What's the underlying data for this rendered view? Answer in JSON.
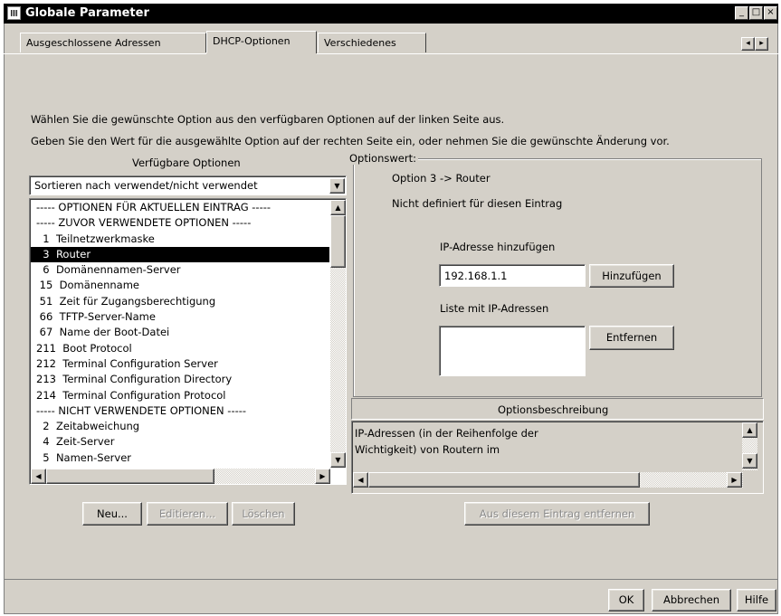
{
  "window": {
    "title": "Globale Parameter",
    "controls": {
      "minimize": "_",
      "maximize": "□",
      "close": "×"
    }
  },
  "tabs": [
    {
      "label": "Ausgeschlossene Adressen",
      "active": false
    },
    {
      "label": "DHCP-Optionen",
      "active": true
    },
    {
      "label": "Verschiedenes",
      "active": false
    }
  ],
  "tab_scroll": {
    "left": "◂",
    "right": "▸"
  },
  "instructions": {
    "line1": "Wählen Sie die gewünschte Option aus den verfügbaren Optionen auf der linken Seite aus.",
    "line2": "Geben Sie den Wert für die ausgewählte Option auf der rechten Seite ein, oder nehmen Sie die gewünschte Änderung vor."
  },
  "available": {
    "heading": "Verfügbare Optionen",
    "sort_select": "Sortieren nach verwendet/nicht verwendet",
    "items": [
      "----- OPTIONEN FÜR AKTUELLEN EINTRAG -----",
      "----- ZUVOR VERWENDETE OPTIONEN -----",
      "  1  Teilnetzwerkmaske",
      "  3  Router",
      "  6  Domänennamen-Server",
      " 15  Domänenname",
      " 51  Zeit für Zugangsberechtigung",
      " 66  TFTP-Server-Name",
      " 67  Name der Boot-Datei",
      "211  Boot Protocol",
      "212  Terminal Configuration Server",
      "213  Terminal Configuration Directory",
      "214  Terminal Configuration Protocol",
      "----- NICHT VERWENDETE OPTIONEN -----",
      "  2  Zeitabweichung",
      "  4  Zeit-Server",
      "  5  Namen-Server"
    ],
    "selected_index": 3
  },
  "option_value": {
    "group_label": "Optionswert:",
    "option_title": "Option 3 -> Router",
    "status": "Nicht definiert für diesen Eintrag",
    "add_ip_label": "IP-Adresse hinzufügen",
    "ip_input": "192.168.1.1",
    "add_button": "Hinzufügen",
    "list_label": "Liste mit IP-Adressen",
    "remove_button": "Entfernen"
  },
  "description": {
    "heading": "Optionsbeschreibung",
    "line1": "IP-Adressen (in der Reihenfolge der",
    "line2": " Wichtigkeit) von Routern im"
  },
  "list_buttons": {
    "new": "Neu...",
    "edit": "Editieren...",
    "delete": "Löschen"
  },
  "remove_from_entry": "Aus diesem Eintrag entfernen",
  "footer": {
    "ok": "OK",
    "cancel": "Abbrechen",
    "help": "Hilfe"
  },
  "scroll_glyphs": {
    "up": "▲",
    "down": "▼",
    "left": "◀",
    "right": "▶"
  }
}
